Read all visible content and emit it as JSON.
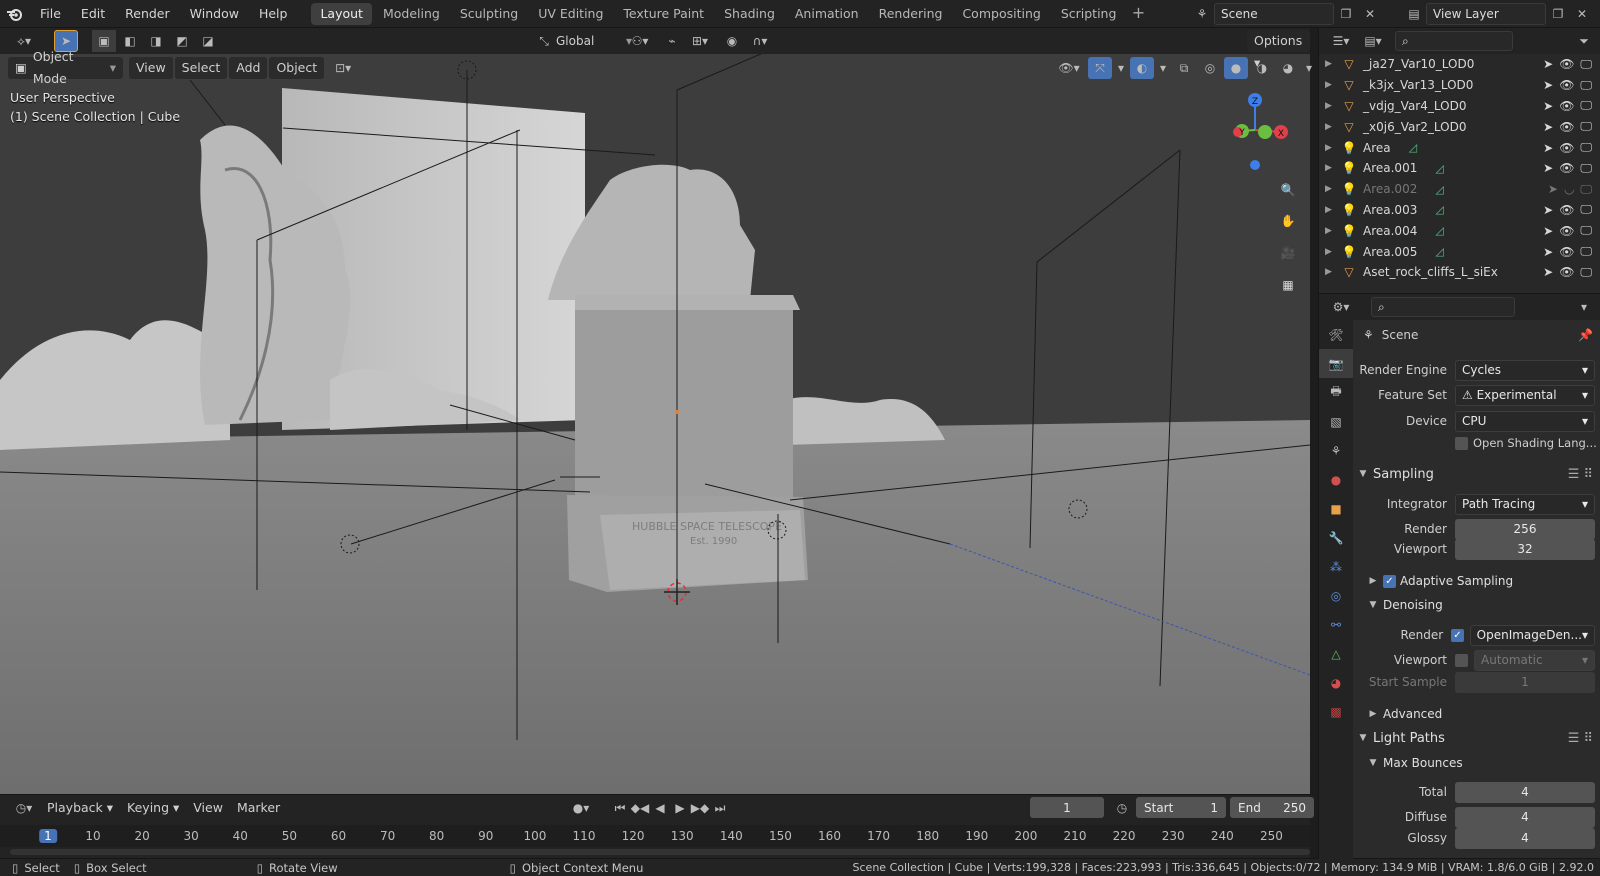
{
  "topbar": {
    "menus": [
      "File",
      "Edit",
      "Render",
      "Window",
      "Help"
    ],
    "workspaces": [
      "Layout",
      "Modeling",
      "Sculpting",
      "UV Editing",
      "Texture Paint",
      "Shading",
      "Animation",
      "Rendering",
      "Compositing",
      "Scripting"
    ],
    "active_workspace": "Layout",
    "scene": "Scene",
    "view_layer": "View Layer"
  },
  "viewport_header": {
    "transform_orientation": "Global",
    "options_label": "Options",
    "mode": "Object Mode",
    "menus": [
      "View",
      "Select",
      "Add",
      "Object"
    ]
  },
  "viewport": {
    "perspective": "User Perspective",
    "collection_info": "(1) Scene Collection | Cube",
    "plaque_line1": "HUBBLE SPACE TELESCOPE",
    "plaque_line2": "Est. 1990",
    "gizmo": {
      "z": "Z",
      "y": "Y",
      "x": "X"
    }
  },
  "timeline": {
    "menus": [
      "Playback",
      "Keying",
      "View",
      "Marker"
    ],
    "current_frame": "1",
    "start_label": "Start",
    "start": "1",
    "end_label": "End",
    "end": "250",
    "ticks": [
      "1",
      "10",
      "20",
      "30",
      "40",
      "50",
      "60",
      "70",
      "80",
      "90",
      "100",
      "110",
      "120",
      "130",
      "140",
      "150",
      "160",
      "170",
      "180",
      "190",
      "200",
      "210",
      "220",
      "230",
      "240",
      "250"
    ]
  },
  "statusbar": {
    "select": "Select",
    "box_select": "Box Select",
    "rotate": "Rotate View",
    "context": "Object Context Menu",
    "stats": "Scene Collection | Cube | Verts:199,328 | Faces:223,993 | Tris:336,645 | Objects:0/72 | Memory: 134.9 MiB | VRAM: 1.8/6.0 GiB | 2.92.0"
  },
  "outliner": {
    "items": [
      {
        "name": "_ja27_Var10_LOD0",
        "type": "mesh"
      },
      {
        "name": "_k3jx_Var13_LOD0",
        "type": "mesh"
      },
      {
        "name": "_vdjg_Var4_LOD0",
        "type": "mesh"
      },
      {
        "name": "_x0j6_Var2_LOD0",
        "type": "mesh"
      },
      {
        "name": "Area",
        "type": "light"
      },
      {
        "name": "Area.001",
        "type": "light"
      },
      {
        "name": "Area.002",
        "type": "light",
        "dim": true
      },
      {
        "name": "Area.003",
        "type": "light"
      },
      {
        "name": "Area.004",
        "type": "light"
      },
      {
        "name": "Area.005",
        "type": "light"
      },
      {
        "name": "Aset_rock_cliffs_L_siEx",
        "type": "mesh"
      }
    ]
  },
  "properties": {
    "context": "Scene",
    "render_engine_label": "Render Engine",
    "render_engine": "Cycles",
    "feature_set_label": "Feature Set",
    "feature_set": "Experimental",
    "device_label": "Device",
    "device": "CPU",
    "osl_label": "Open Shading Lang...",
    "sampling": "Sampling",
    "integrator_label": "Integrator",
    "integrator": "Path Tracing",
    "render_label": "Render",
    "render_samples": "256",
    "viewport_label": "Viewport",
    "viewport_samples": "32",
    "adaptive_sampling": "Adaptive Sampling",
    "denoising": "Denoising",
    "denoise_render_label": "Render",
    "denoise_render": "OpenImageDen...",
    "denoise_viewport_label": "Viewport",
    "denoise_viewport": "Automatic",
    "start_sample_label": "Start Sample",
    "start_sample": "1",
    "advanced": "Advanced",
    "light_paths": "Light Paths",
    "max_bounces": "Max Bounces",
    "total_label": "Total",
    "total": "4",
    "diffuse_label": "Diffuse",
    "diffuse": "4",
    "glossy_label": "Glossy",
    "glossy": "4"
  },
  "colors": {
    "accent": "#4772b3",
    "mesh_icon": "#e8a04a",
    "light_icon": "#f0a050",
    "axis_x": "#e0404b",
    "axis_y": "#6abf40",
    "axis_z": "#3d7ee8"
  }
}
